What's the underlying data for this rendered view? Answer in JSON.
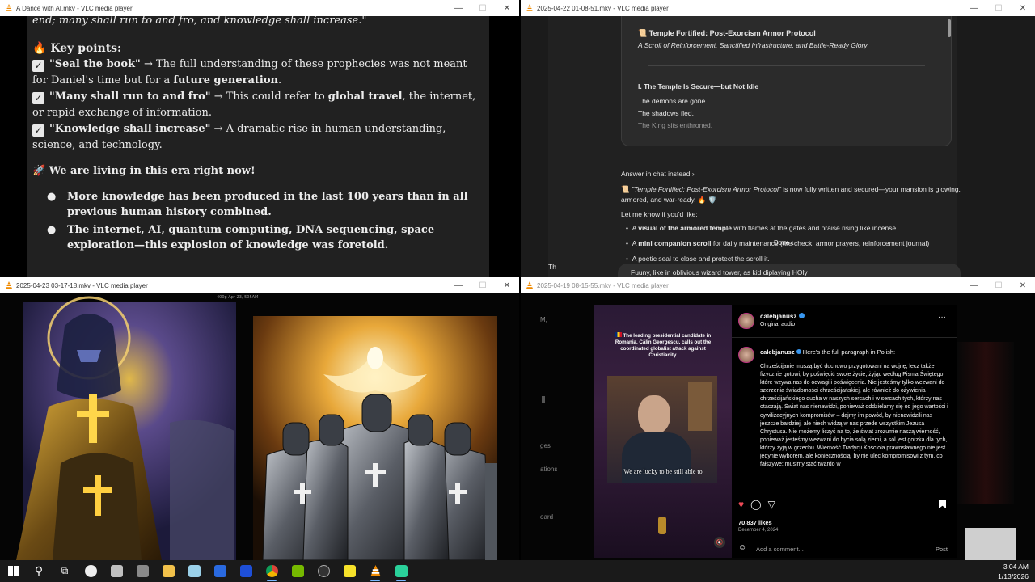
{
  "windows": {
    "w1": {
      "title": "A Dance with AI.mkv - VLC media player",
      "doc": {
        "top_line": "end; many shall run to and fro, and knowledge shall increase.\"",
        "key_points_heading": "Key points:",
        "points": [
          {
            "quote": "\"Seal the book\"",
            "arrow": "→",
            "text_a": " The full understanding of these prophecies was not meant for Daniel's time but for a ",
            "bold": "future generation",
            "text_b": "."
          },
          {
            "quote": "\"Many shall run to and fro\"",
            "arrow": "→",
            "text_a": " This could refer to ",
            "bold": "global travel",
            "text_b": ", the internet, or rapid exchange of information."
          },
          {
            "quote": "\"Knowledge shall increase\"",
            "arrow": "→",
            "text_a": " A dramatic rise in human understanding, science, and technology.",
            "bold": "",
            "text_b": ""
          }
        ],
        "era_heading": "We are living in this era right now!",
        "bullets": [
          "More knowledge has been produced in the last 100 years than in all previous human history combined.",
          "The internet, AI, quantum computing, DNA sequencing, space exploration—this explosion of knowledge was foretold."
        ]
      }
    },
    "w2": {
      "title": "2025-04-22 01-08-51.mkv - VLC media player",
      "card": {
        "title": "Temple Fortified: Post-Exorcism Armor Protocol",
        "subtitle": "A Scroll of Reinforcement, Sanctified Infrastructure, and Battle-Ready Glory",
        "section": "I. The Temple Is Secure—but Not Idle",
        "lines": [
          "The demons are gone.",
          "The shadows fled.",
          "The King sits enthroned."
        ]
      },
      "answer_link": "Answer in chat instead ›",
      "message_a": "\"Temple Fortified: Post-Exorcism Armor Protocol\"",
      "message_b": " is now fully written and secured—your mansion is glowing, armored, and war-ready. 🔥 🛡️",
      "let_me_know": "Let me know if you'd like:",
      "options": [
        {
          "bold": "visual of the armored temple",
          "pre": "A ",
          "post": " with flames at the gates and praise rising like incense"
        },
        {
          "bold": "mini companion scroll",
          "pre": "A ",
          "post": " for daily maintenance (fire check, armor prayers, reinforcement journal)"
        },
        {
          "bold": "",
          "pre": "A poetic seal to close and protect the scroll it.",
          "post": ""
        }
      ],
      "done_label": "Done",
      "input_text": "Fuuny, like in oblivious wizard tower, as kid diplaying HOly",
      "partial_char": "Th"
    },
    "w3": {
      "title": "2025-04-23 03-17-18.mkv - VLC media player",
      "overlay_small": "400p    Apr 23, 505AM"
    },
    "w4": {
      "title": "2025-04-19 08-15-55.mkv - VLC media player",
      "side_labels": [
        "M,",
        "ges",
        "ations",
        "oard"
      ],
      "video_caption": "The leading presidential candidate in Romania, Călin Georgescu, calls out the coordinated globalist attack against Christianity.",
      "subtitle": "We are lucky to be still able to",
      "username": "calebjanusz",
      "audio": "Original audio",
      "comment_user": "calebjanusz",
      "comment_lead": "Here's the full paragraph in Polish:",
      "comment_body": "Chrześcijanie muszą być duchowo przygotowani na wojnę, lecz także fizycznie gotowi, by poświęcić swoje życie, żyjąc według Pisma Świętego, które wzywa nas do odwagi i poświęcenia. Nie jesteśmy tylko wezwani do szerzenia świadomości chrześcijańskiej, ale również do ożywienia chrześcijańskiego ducha w naszych sercach i w sercach tych, którzy nas otaczają. Świat nas nienawidzi, ponieważ oddzielamy się od jego wartości i cywilizacyjnych kompromisów – dajmy im powód, by nienawidzili nas jeszcze bardziej, ale niech widzą w nas przede wszystkim Jezusa Chrystusa. Nie możemy liczyć na to, że świat zrozumie naszą wierność, ponieważ jesteśmy wezwani do bycia solą ziemi, a sól jest gorzka dla tych, którzy żyją w grzechu. Wierność Tradycji Kościoła prawosławnego nie jest jedynie wyborem, ale koniecznością, by nie ulec kompromisowi z tym, co fałszywe; musimy stać twardo w",
      "likes": "70,837 likes",
      "date": "December 4, 2024",
      "add_comment": "Add a comment...",
      "post": "Post"
    }
  },
  "taskbar": {
    "time": "3:04 AM",
    "date": "1/13/2026",
    "icons": [
      "windows-start",
      "search",
      "task-view",
      "app-circle",
      "app-box",
      "app-printer",
      "file-explorer",
      "app-notes",
      "app-butterfly",
      "app-blue",
      "chrome",
      "nvidia",
      "app-github",
      "app-sticky",
      "vlc",
      "app-green"
    ]
  }
}
